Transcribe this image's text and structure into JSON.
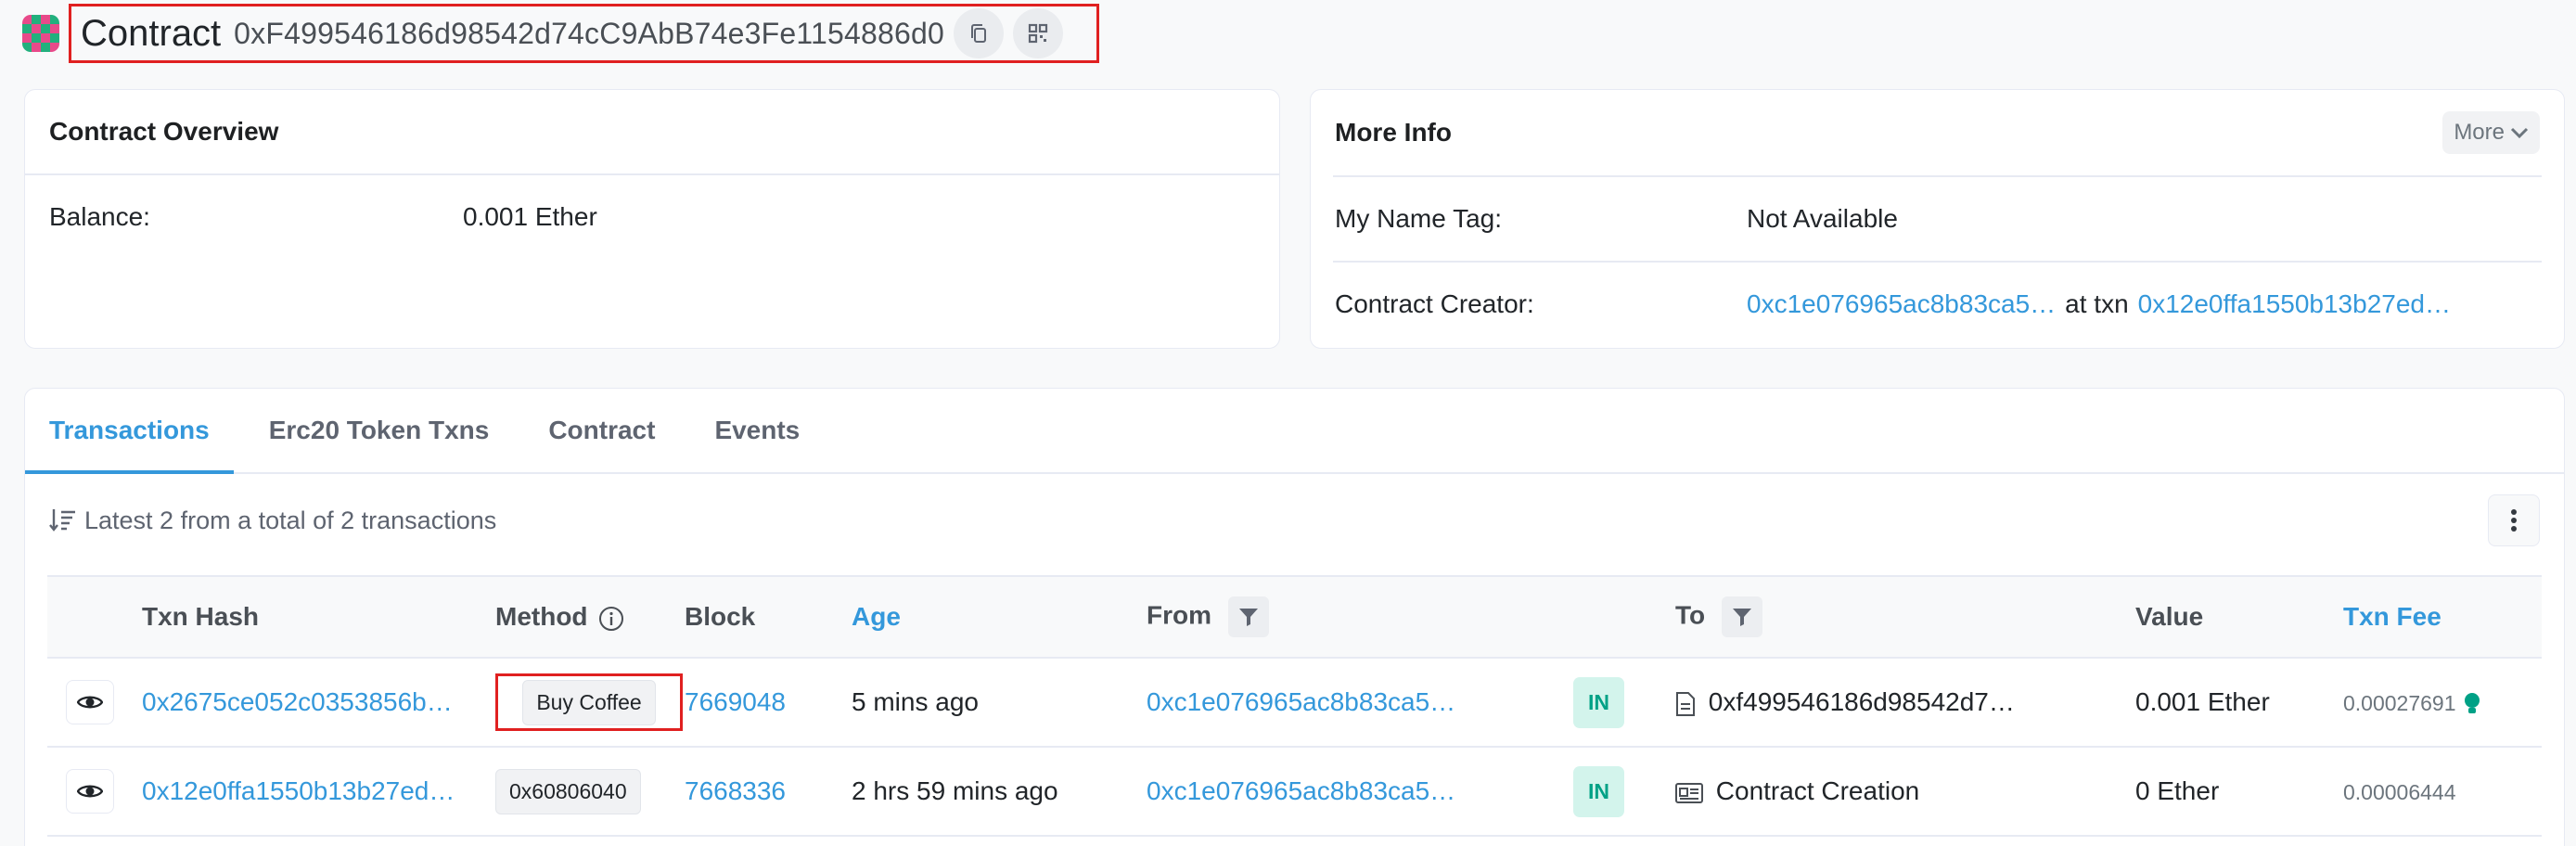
{
  "header": {
    "label": "Contract",
    "address": "0xF499546186d98542d74cC9AbB74e3Fe1154886d0",
    "copy_icon": "copy-icon",
    "qr_icon": "qr-code-icon"
  },
  "overview": {
    "title": "Contract Overview",
    "balance_label": "Balance:",
    "balance_value": "0.001 Ether"
  },
  "more_info": {
    "title": "More Info",
    "more_button": "More",
    "name_tag_label": "My Name Tag:",
    "name_tag_value": "Not Available",
    "creator_label": "Contract Creator:",
    "creator_address": "0xc1e076965ac8b83ca5…",
    "at_txn_label": "at txn",
    "creator_txn": "0x12e0ffa1550b13b27ed…"
  },
  "tabs": [
    "Transactions",
    "Erc20 Token Txns",
    "Contract",
    "Events"
  ],
  "summary_text": "Latest 2 from a total of 2 transactions",
  "table": {
    "headers": {
      "txn_hash": "Txn Hash",
      "method": "Method",
      "block": "Block",
      "age": "Age",
      "from": "From",
      "to": "To",
      "value": "Value",
      "txn_fee": "Txn Fee"
    },
    "rows": [
      {
        "hash": "0x2675ce052c0353856b…",
        "method": "Buy Coffee",
        "block": "7669048",
        "age": "5 mins ago",
        "from": "0xc1e076965ac8b83ca5…",
        "direction": "IN",
        "to": "0xf499546186d98542d7…",
        "value": "0.001 Ether",
        "fee": "0.00027691"
      },
      {
        "hash": "0x12e0ffa1550b13b27ed…",
        "method": "0x60806040",
        "block": "7668336",
        "age": "2 hrs 59 mins ago",
        "from": "0xc1e076965ac8b83ca5…",
        "direction": "IN",
        "to": "Contract Creation",
        "value": "0 Ether",
        "fee": "0.00006444"
      }
    ]
  },
  "colors": {
    "link": "#3498db",
    "in_badge_bg": "#d3f4ec",
    "in_badge_text": "#00a186",
    "highlight": "#e02020"
  }
}
